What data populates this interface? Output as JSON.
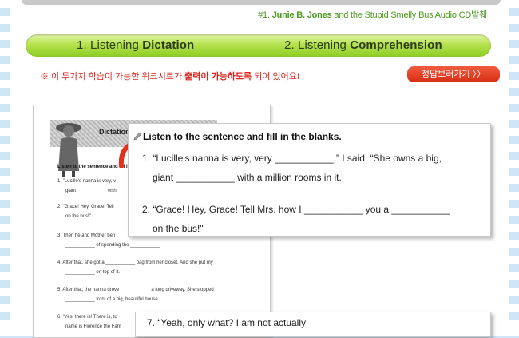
{
  "caption": {
    "prefix": "#1.",
    "title_bold": "Junie B. Jones",
    "suffix": "and the Stupid Smelly Bus Audio CD발췌"
  },
  "tabs": [
    {
      "number": "1.",
      "word": "Listening",
      "bold": "Dictation"
    },
    {
      "number": "2.",
      "word": "Listening",
      "bold": "Comprehension"
    }
  ],
  "notice": {
    "prefix": "※ 이 두가지 학습이 가능한 워크시트가",
    "highlight": "출력이 가능하도록",
    "suffix": "되어 있어요!"
  },
  "answer_button": "정답보러가기 〉〉",
  "sheet": {
    "title": "Dictation",
    "subheading": "Listen to the sentence and fill in the blanks.",
    "lines": [
      "1. \"Lucille's nanna is very, v",
      "giant ___________ with",
      "2. \"Grace! Hey, Grace! Tell",
      "on the bus!\"",
      "3. Then he and Mother ben",
      "___________ of spending the ___________.",
      "4. After that, she got a ___________ bag from her closet. And she put my",
      "___________ on top of it.",
      "5. After that, the nanna drove ___________ a long driveway. She stopped",
      "___________ front of a big, beautiful house.",
      "6. \"Yes, there is! There is, to",
      "name is Florence the Fam"
    ]
  },
  "zoom": {
    "instruction": "Listen to the sentence and fill in the blanks.",
    "item1_line1": "1. “Lucille's nanna is very, very ___________,” I said. “She owns a big,",
    "item1_line2": "giant ___________ with a million rooms in it.",
    "item2_line1": "2. “Grace! Hey, Grace! Tell Mrs. how I ___________ you a ___________",
    "item2_line2": "on the bus!\""
  },
  "zoom_bottom": "7. “Yeah, only                         what? I am not actually"
}
